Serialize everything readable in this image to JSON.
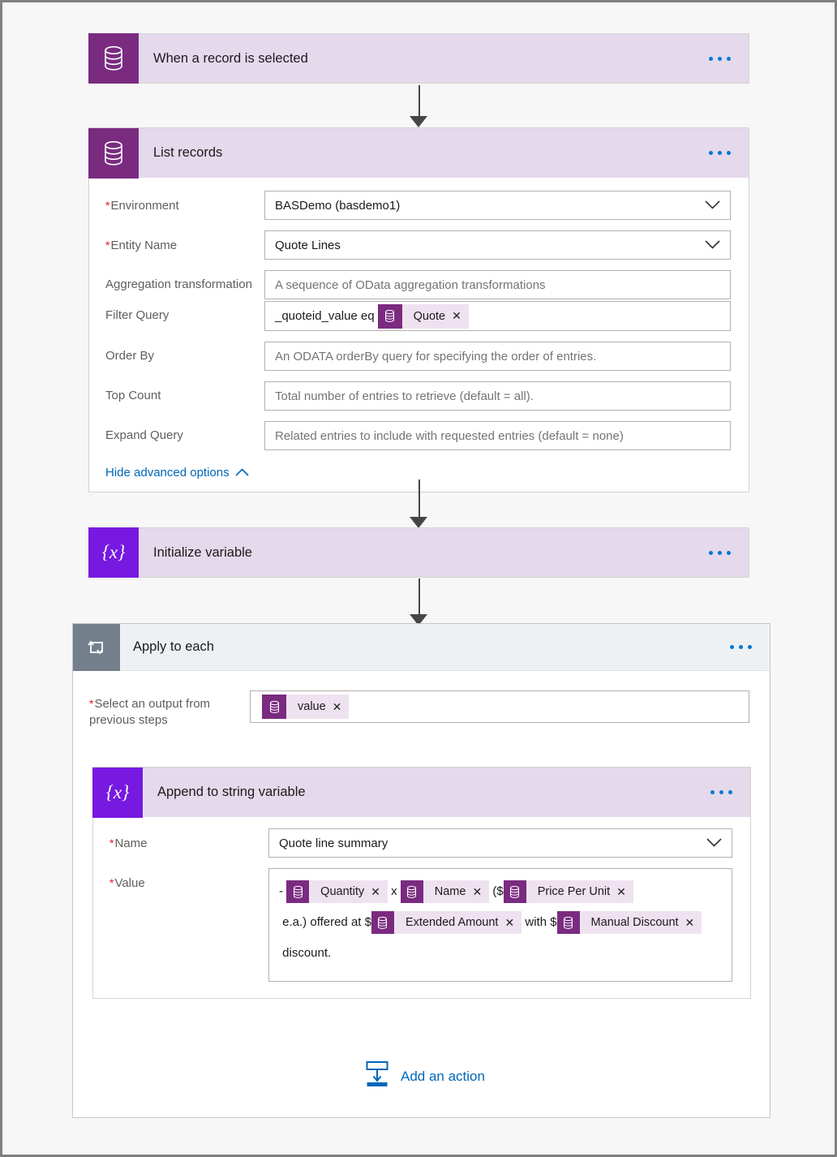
{
  "flow": {
    "trigger": {
      "title": "When a record is selected",
      "icon": "dataverse-icon",
      "menu": "more-options"
    },
    "list_records": {
      "title": "List records",
      "icon": "dataverse-icon",
      "fields": [
        {
          "label": "Environment",
          "required": true,
          "value": "BASDemo (basdemo1)",
          "type": "dropdown"
        },
        {
          "label": "Entity Name",
          "required": true,
          "value": "Quote Lines",
          "type": "dropdown"
        },
        {
          "label": "Aggregation transformation",
          "required": false,
          "placeholder": "A sequence of OData aggregation transformations",
          "type": "text"
        },
        {
          "label": "Filter Query",
          "required": false,
          "prefix": "_quoteid_value eq",
          "token": "Quote",
          "type": "token"
        },
        {
          "label": "Order By",
          "required": false,
          "placeholder": "An ODATA orderBy query for specifying the order of entries.",
          "type": "text"
        },
        {
          "label": "Top Count",
          "required": false,
          "placeholder": "Total number of entries to retrieve (default = all).",
          "type": "text"
        },
        {
          "label": "Expand Query",
          "required": false,
          "placeholder": "Related entries to include with requested entries (default = none)",
          "type": "text"
        }
      ],
      "advanced_link": "Hide advanced options"
    },
    "initialize_variable": {
      "title": "Initialize variable",
      "icon": "variable-icon"
    },
    "apply_to_each": {
      "title": "Apply to each",
      "icon": "loop-icon",
      "output_label": "Select an output from previous steps",
      "output_required": true,
      "output_token": "value",
      "append": {
        "title": "Append to string variable",
        "icon": "variable-icon",
        "name_label": "Name",
        "name_required": true,
        "name_value": "Quote line summary",
        "value_label": "Value",
        "value_required": true,
        "value_parts": [
          {
            "kind": "text",
            "text": "- "
          },
          {
            "kind": "token",
            "text": "Quantity"
          },
          {
            "kind": "text",
            "text": " x "
          },
          {
            "kind": "token",
            "text": "Name"
          },
          {
            "kind": "text",
            "text": " ($"
          },
          {
            "kind": "token",
            "text": "Price Per Unit"
          },
          {
            "kind": "text",
            "text": " e.a.) offered at $"
          },
          {
            "kind": "token",
            "text": "Extended Amount"
          },
          {
            "kind": "text",
            "text": " with $"
          },
          {
            "kind": "token",
            "text": "Manual Discount"
          },
          {
            "kind": "text",
            "text": " discount."
          }
        ]
      },
      "add_action_label": "Add an action",
      "add_action_icon": "add-action-icon"
    }
  },
  "colors": {
    "dataverse_tile": "#7a2b80",
    "variable_tile": "#7719e0",
    "loop_tile": "#73808c",
    "card_header_bg": "#e5d9ec",
    "token_bg": "#efe2f0",
    "link_blue": "#0067b8",
    "menu_dot_blue": "#0078d4",
    "required_red": "#e81123",
    "canvas_bg": "#f7f7f7"
  }
}
